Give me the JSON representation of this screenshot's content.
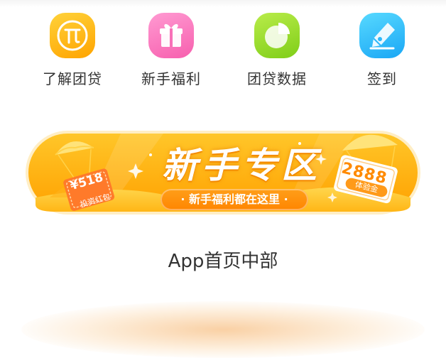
{
  "entries": [
    {
      "label": "了解团贷",
      "icon": "pi-icon",
      "color": "#ffb000"
    },
    {
      "label": "新手福利",
      "icon": "gift-icon",
      "color": "#f871bb"
    },
    {
      "label": "团贷数据",
      "icon": "pie-chart-icon",
      "color": "#93d92a"
    },
    {
      "label": "签到",
      "icon": "pen-nib-icon",
      "color": "#2cb8fb"
    }
  ],
  "banner": {
    "title": "新手专区",
    "subtitle": "· 新手福利都在这里 ·",
    "left_ticket": {
      "amount": "¥518",
      "text": "投资红包"
    },
    "right_ticket": {
      "amount": "2888",
      "text": "体验金"
    },
    "colors": {
      "main": "#ffb20a",
      "accent": "#ff8a00"
    }
  },
  "caption": "App首页中部"
}
